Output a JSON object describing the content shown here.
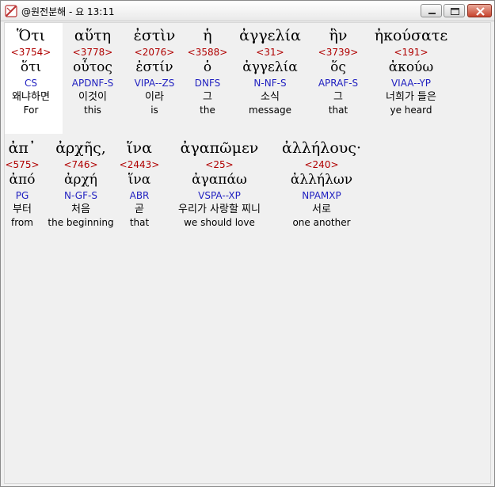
{
  "window": {
    "title": "@원전분해 - 요 13:11",
    "icon": "app-book-icon"
  },
  "colors": {
    "strong": "#b00000",
    "parse": "#1f1fc0",
    "highlight": "#ffffff",
    "background": "#f0f0f0"
  },
  "lines": [
    {
      "words": [
        {
          "greek": "Ὅτι",
          "strong": "<3754>",
          "lemma": "ὅτι",
          "parse": "CS",
          "korean": "왜냐하면",
          "english": "For"
        },
        {
          "greek": "αὕτη",
          "strong": "<3778>",
          "lemma": "οὗτος",
          "parse": "APDNF-S",
          "korean": "이것이",
          "english": "this"
        },
        {
          "greek": "ἐστὶν",
          "strong": "<2076>",
          "lemma": "ἐστίν",
          "parse": "VIPA--ZS",
          "korean": "이라",
          "english": "is"
        },
        {
          "greek": "ἡ",
          "strong": "<3588>",
          "lemma": "ὁ",
          "parse": "DNFS",
          "korean": "그",
          "english": "the"
        },
        {
          "greek": "ἀγγελία",
          "strong": "<31>",
          "lemma": "ἀγγελία",
          "parse": "N-NF-S",
          "korean": "소식",
          "english": "message"
        },
        {
          "greek": "ἣν",
          "strong": "<3739>",
          "lemma": "ὅς",
          "parse": "APRAF-S",
          "korean": "그",
          "english": "that"
        },
        {
          "greek": "ἠκούσατε",
          "strong": "<191>",
          "lemma": "ἀκούω",
          "parse": "VIAA--YP",
          "korean": "너희가 들은",
          "english": "ye heard"
        }
      ]
    },
    {
      "words": [
        {
          "greek": "ἀπ᾽",
          "strong": "<575>",
          "lemma": "ἀπό",
          "parse": "PG",
          "korean": "부터",
          "english": "from"
        },
        {
          "greek": "ἀρχῆς,",
          "strong": "<746>",
          "lemma": "ἀρχή",
          "parse": "N-GF-S",
          "korean": "처음",
          "english": "the beginning"
        },
        {
          "greek": "ἵνα",
          "strong": "<2443>",
          "lemma": "ἵνα",
          "parse": "ABR",
          "korean": "곧",
          "english": "that"
        },
        {
          "greek": "ἀγαπῶμεν",
          "strong": "<25>",
          "lemma": "ἀγαπάω",
          "parse": "VSPA--XP",
          "korean": "우리가 사랑할 찌니",
          "english": "we should love"
        },
        {
          "greek": "ἀλλήλους·",
          "strong": "<240>",
          "lemma": "ἀλλήλων",
          "parse": "NPAMXP",
          "korean": "서로",
          "english": "one another"
        }
      ]
    }
  ]
}
